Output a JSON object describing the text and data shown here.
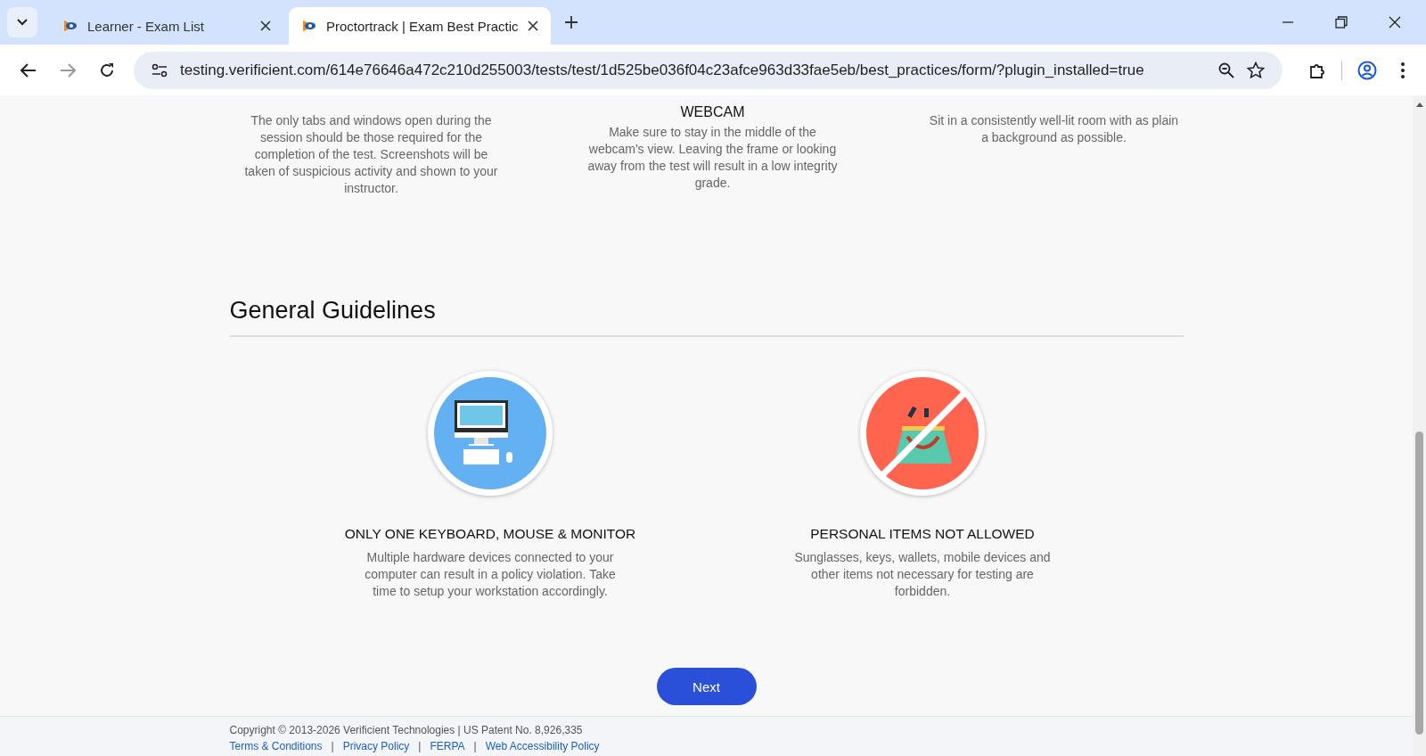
{
  "browser": {
    "tabs": [
      {
        "title": "Learner - Exam List",
        "selected": false
      },
      {
        "title": "Proctortrack | Exam Best Practic",
        "selected": true
      }
    ],
    "url": "testing.verificient.com/614e76646a472c210d255003/tests/test/1d525be036f04c23afce963d33fae5eb/best_practices/form/?plugin_installed=true"
  },
  "top_practices": [
    {
      "text": "The only tabs and windows open during the session should be those required for the completion of the test. Screenshots will be taken of suspicious activity and shown to your instructor."
    },
    {
      "heading": "WEBCAM",
      "text": "Make sure to stay in the middle of the webcam's view. Leaving the frame or looking away from the test will result in a low integrity grade."
    },
    {
      "text": "Sit in a consistently well-lit room with as plain a background as possible."
    }
  ],
  "section_title": "General Guidelines",
  "guidelines": [
    {
      "kind": "computer",
      "heading": "ONLY ONE KEYBOARD, MOUSE & MONITOR",
      "text": "Multiple hardware devices connected to your computer can result in a policy violation. Take time to setup your workstation accordingly."
    },
    {
      "kind": "no-bag",
      "heading": "PERSONAL ITEMS NOT ALLOWED",
      "text": "Sunglasses, keys, wallets, mobile devices and other items not necessary for testing are forbidden."
    }
  ],
  "next_button": "Next",
  "footer": {
    "copyright": "Copyright © 2013-2026 Verificient Technologies | US Patent No. 8,926,335",
    "links": [
      "Terms & Conditions",
      "Privacy Policy",
      "FERPA",
      "Web Accessibility Policy"
    ],
    "separator": "|"
  }
}
